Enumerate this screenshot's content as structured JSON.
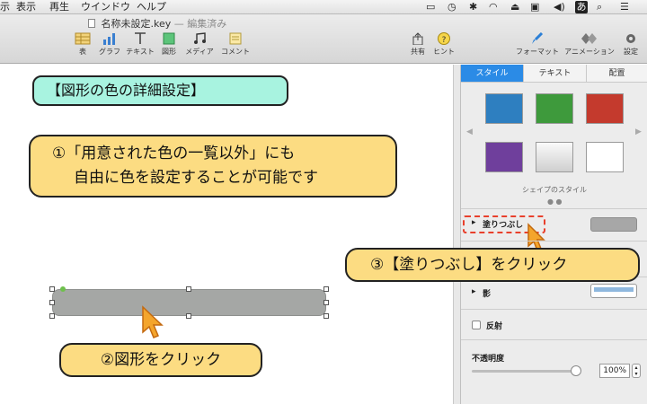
{
  "menubar": {
    "items": [
      "示",
      "表示",
      "再生",
      "ウインドウ",
      "ヘルプ"
    ],
    "input_mode": "あ"
  },
  "toolbar": {
    "doc_title": "名称未設定.key",
    "doc_status": "— 編集済み",
    "left_tools": [
      {
        "label": "表",
        "icon": "table-icon"
      },
      {
        "label": "グラフ",
        "icon": "chart-icon"
      },
      {
        "label": "テキスト",
        "icon": "text-icon"
      },
      {
        "label": "図形",
        "icon": "shape-icon"
      },
      {
        "label": "メディア",
        "icon": "media-icon"
      },
      {
        "label": "コメント",
        "icon": "comment-icon"
      }
    ],
    "share_label": "共有",
    "tips_label": "ヒント",
    "format_label": "フォーマット",
    "animation_label": "アニメーション",
    "document_label": "設定"
  },
  "canvas": {
    "title": "【図形の色の詳細設定】",
    "note1_line1": "①「用意された色の一覧以外」にも",
    "note1_line2": "自由に色を設定することが可能です",
    "note2": "②図形をクリック",
    "note3": "③【塗りつぶし】をクリック",
    "shape_color": "#a5a7a5"
  },
  "inspector": {
    "tabs": [
      "スタイル",
      "テキスト",
      "配置"
    ],
    "active_tab": "スタイル",
    "swatch_colors": [
      "#2e7fc0",
      "#3e9a3c",
      "#c43a2d",
      "#6f3f9c",
      "#e6e6e6",
      "#ffffff"
    ],
    "shape_styles_label": "シェイプのスタイル",
    "fill_label": "塗りつぶし",
    "fill_color": "#a7a7a7",
    "shadow_label": "影",
    "reflection_label": "反射",
    "opacity_label": "不透明度",
    "opacity_value": "100%"
  },
  "colors": {
    "accent": "#2b8be6",
    "callout_yellow": "#fcdc82",
    "callout_cyan": "#a8f3e0",
    "highlight_red": "#e8402c"
  }
}
